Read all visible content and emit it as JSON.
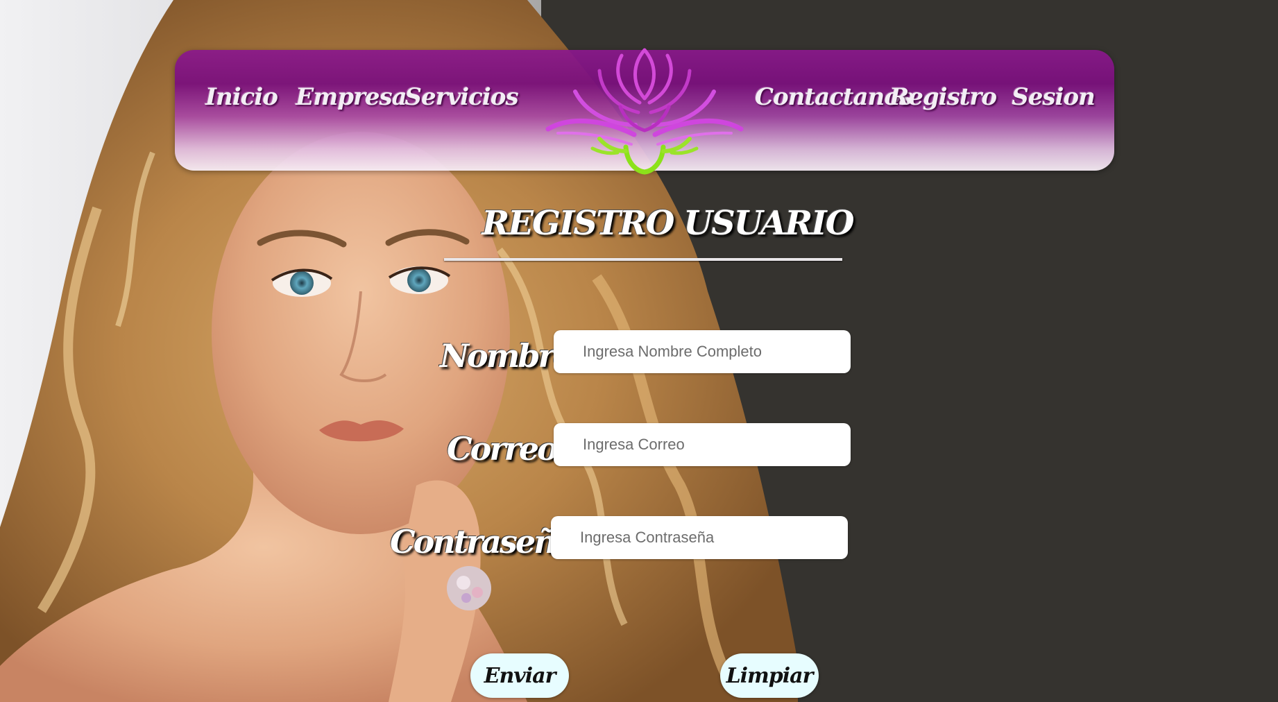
{
  "nav": {
    "items": [
      {
        "label": "Inicio"
      },
      {
        "label": "Empresa"
      },
      {
        "label": "Servicios"
      },
      {
        "label": "Contactanos"
      },
      {
        "label": "Registro"
      },
      {
        "label": "Sesion"
      }
    ],
    "logo_icon": "lotus-icon"
  },
  "page": {
    "title": "REGISTRO USUARIO"
  },
  "form": {
    "name_label": "Nombre:",
    "name_placeholder": "Ingresa Nombre Completo",
    "email_label": "Correo:",
    "email_placeholder": "Ingresa Correo",
    "password_label": "Contraseña:",
    "password_placeholder": "Ingresa Contraseña",
    "submit_label": "Enviar",
    "reset_label": "Limpiar"
  },
  "colors": {
    "nav_purple": "#7a107c",
    "background_dark": "#35332f",
    "button_bg": "#e7fdff"
  }
}
